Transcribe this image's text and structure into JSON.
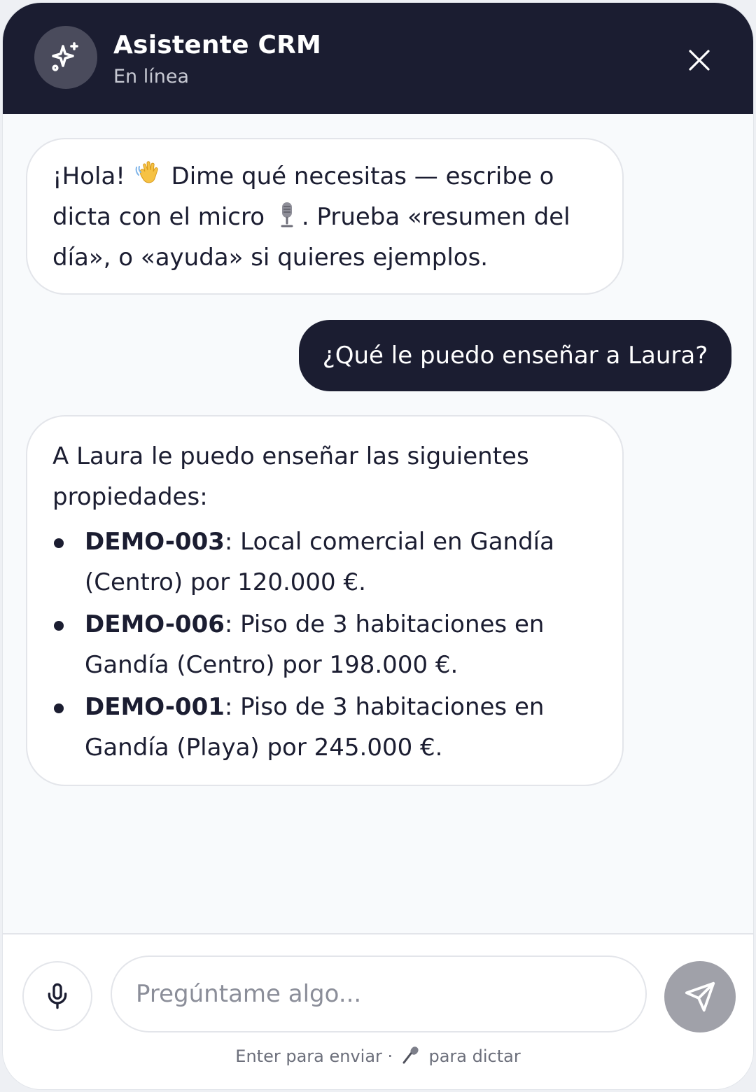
{
  "header": {
    "title": "Asistente CRM",
    "status": "En línea",
    "avatar_icon": "sparkles-icon",
    "close_icon": "close-icon"
  },
  "messages": [
    {
      "role": "assistant",
      "text_before_wave": "¡Hola!",
      "text_after_wave": "Dime qué necesitas — escribe o dicta con el micro",
      "text_after_mic": ". Prueba «resumen del día», o «ayuda» si quieres ejemplos."
    },
    {
      "role": "user",
      "text": "¿Qué le puedo enseñar a Laura?"
    },
    {
      "role": "assistant",
      "intro": "A Laura le puedo enseñar las siguientes propiedades:",
      "items": [
        {
          "code": "DEMO-003",
          "text": ": Local comercial en Gandía (Centro) por 120.000 €."
        },
        {
          "code": "DEMO-006",
          "text": ": Piso de 3 habitaciones en Gandía (Centro) por 198.000 €."
        },
        {
          "code": "DEMO-001",
          "text": ": Piso de 3 habitaciones en Gandía (Playa) por 245.000 €."
        }
      ]
    }
  ],
  "composer": {
    "placeholder": "Pregúntame algo...",
    "value": "",
    "mic_icon": "microphone-icon",
    "send_icon": "send-icon",
    "hint_before": "Enter para enviar ·",
    "hint_after": "para dictar"
  },
  "colors": {
    "header_bg": "#1b1d31",
    "user_bubble": "#1b1d31",
    "send_button_disabled": "#a0a1a9",
    "background": "#f8fafc"
  }
}
